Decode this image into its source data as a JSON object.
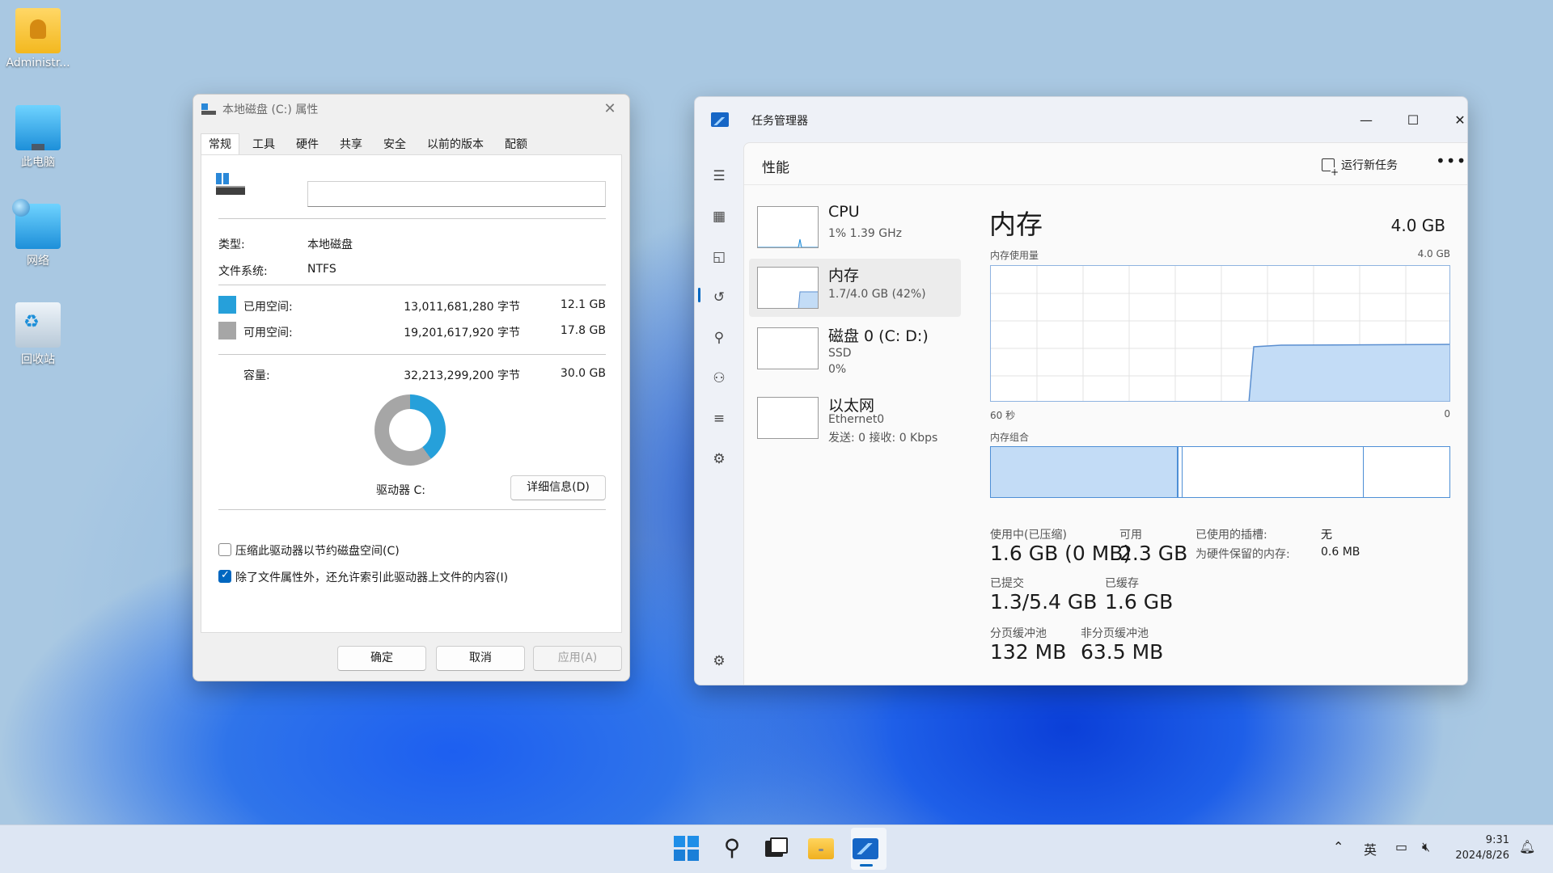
{
  "desktop": {
    "icons": [
      {
        "label": "Administr...",
        "icon": "user-folder-icon"
      },
      {
        "label": "此电脑",
        "icon": "this-pc-icon"
      },
      {
        "label": "网络",
        "icon": "network-icon"
      },
      {
        "label": "回收站",
        "icon": "recycle-bin-icon"
      }
    ]
  },
  "props": {
    "title": "本地磁盘 (C:) 属性",
    "tabs": [
      "常规",
      "工具",
      "硬件",
      "共享",
      "安全",
      "以前的版本",
      "配额"
    ],
    "name_value": "",
    "type_label": "类型:",
    "type_value": "本地磁盘",
    "fs_label": "文件系统:",
    "fs_value": "NTFS",
    "used_label": "已用空间:",
    "used_bytes": "13,011,681,280 字节",
    "used_gb": "12.1 GB",
    "free_label": "可用空间:",
    "free_bytes": "19,201,617,920 字节",
    "free_gb": "17.8 GB",
    "cap_label": "容量:",
    "cap_bytes": "32,213,299,200 字节",
    "cap_gb": "30.0 GB",
    "used_fraction": 0.4,
    "drive_label": "驱动器 C:",
    "details_button": "详细信息(D)",
    "compress_label": "压缩此驱动器以节约磁盘空间(C)",
    "compress_checked": false,
    "index_label": "除了文件属性外，还允许索引此驱动器上文件的内容(I)",
    "index_checked": true,
    "ok": "确定",
    "cancel": "取消",
    "apply": "应用(A)"
  },
  "tm": {
    "title": "任务管理器",
    "page_title": "性能",
    "run_task": "运行新任务",
    "resources": [
      {
        "name": "CPU",
        "sub1": "1% 1.39 GHz",
        "sub2": ""
      },
      {
        "name": "内存",
        "sub1": "1.7/4.0 GB (42%)",
        "sub2": ""
      },
      {
        "name": "磁盘 0 (C: D:)",
        "sub1": "SSD",
        "sub2": "0%"
      },
      {
        "name": "以太网",
        "sub1": "Ethernet0",
        "sub2": "发送: 0 接收: 0 Kbps"
      }
    ],
    "memory": {
      "heading": "内存",
      "total": "4.0 GB",
      "usage_label": "内存使用量",
      "usage_max": "4.0 GB",
      "axis_left": "60 秒",
      "axis_right": "0",
      "composition_label": "内存组合",
      "in_use_fraction_of_graph": 0.42,
      "in_use_label": "使用中(已压缩)",
      "in_use_value": "1.6 GB (0 MB)",
      "available_label": "可用",
      "available_value": "2.3 GB",
      "slots_label": "已使用的插槽:",
      "slots_value": "无",
      "reserved_label": "为硬件保留的内存:",
      "reserved_value": "0.6 MB",
      "committed_label": "已提交",
      "committed_value": "1.3/5.4 GB",
      "cached_label": "已缓存",
      "cached_value": "1.6 GB",
      "paged_label": "分页缓冲池",
      "paged_value": "132 MB",
      "nonpaged_label": "非分页缓冲池",
      "nonpaged_value": "63.5 MB"
    }
  },
  "taskbar": {
    "tray_lang": "英",
    "time": "9:31",
    "date": "2024/8/26"
  }
}
